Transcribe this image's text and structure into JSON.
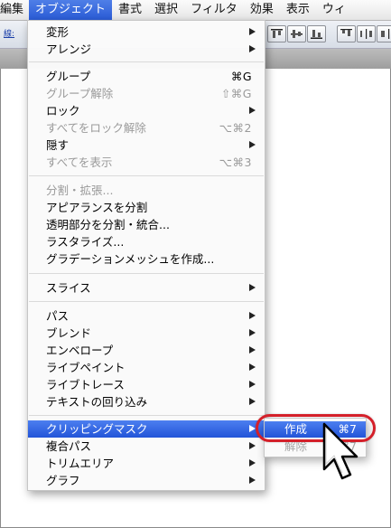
{
  "menubar": {
    "items": [
      {
        "label": "編集"
      },
      {
        "label": "オブジェクト"
      },
      {
        "label": "書式"
      },
      {
        "label": "選択"
      },
      {
        "label": "フィルタ"
      },
      {
        "label": "効果"
      },
      {
        "label": "表示"
      },
      {
        "label": "ウィ"
      }
    ]
  },
  "toolbar": {
    "stroke_label": "線:"
  },
  "object_menu": {
    "items": [
      {
        "label": "変形",
        "submenu": true
      },
      {
        "label": "アレンジ",
        "submenu": true
      },
      {
        "label": "グループ",
        "shortcut": "⌘G"
      },
      {
        "label": "グループ解除",
        "shortcut": "⇧⌘G",
        "disabled": true
      },
      {
        "label": "ロック",
        "submenu": true
      },
      {
        "label": "すべてをロック解除",
        "shortcut": "⌥⌘2",
        "disabled": true
      },
      {
        "label": "隠す",
        "submenu": true
      },
      {
        "label": "すべてを表示",
        "shortcut": "⌥⌘3",
        "disabled": true
      },
      {
        "label": "分割・拡張...",
        "disabled": true
      },
      {
        "label": "アピアランスを分割"
      },
      {
        "label": "透明部分を分割・統合..."
      },
      {
        "label": "ラスタライズ..."
      },
      {
        "label": "グラデーションメッシュを作成..."
      },
      {
        "label": "スライス",
        "submenu": true
      },
      {
        "label": "パス",
        "submenu": true
      },
      {
        "label": "ブレンド",
        "submenu": true
      },
      {
        "label": "エンベロープ",
        "submenu": true
      },
      {
        "label": "ライブペイント",
        "submenu": true
      },
      {
        "label": "ライブトレース",
        "submenu": true
      },
      {
        "label": "テキストの回り込み",
        "submenu": true
      },
      {
        "label": "クリッピングマスク",
        "submenu": true,
        "selected": true
      },
      {
        "label": "複合パス",
        "submenu": true
      },
      {
        "label": "トリムエリア",
        "submenu": true
      },
      {
        "label": "グラフ",
        "submenu": true
      }
    ]
  },
  "clipping_submenu": {
    "items": [
      {
        "label": "作成",
        "shortcut": "⌘7",
        "selected": true
      },
      {
        "label": "解除",
        "shortcut": "⌥⌘7",
        "disabled": true
      }
    ]
  },
  "colors": {
    "selection": "#2a5bd6",
    "highlight_ring": "#d4202a",
    "disabled_text": "#9a9a9a"
  }
}
